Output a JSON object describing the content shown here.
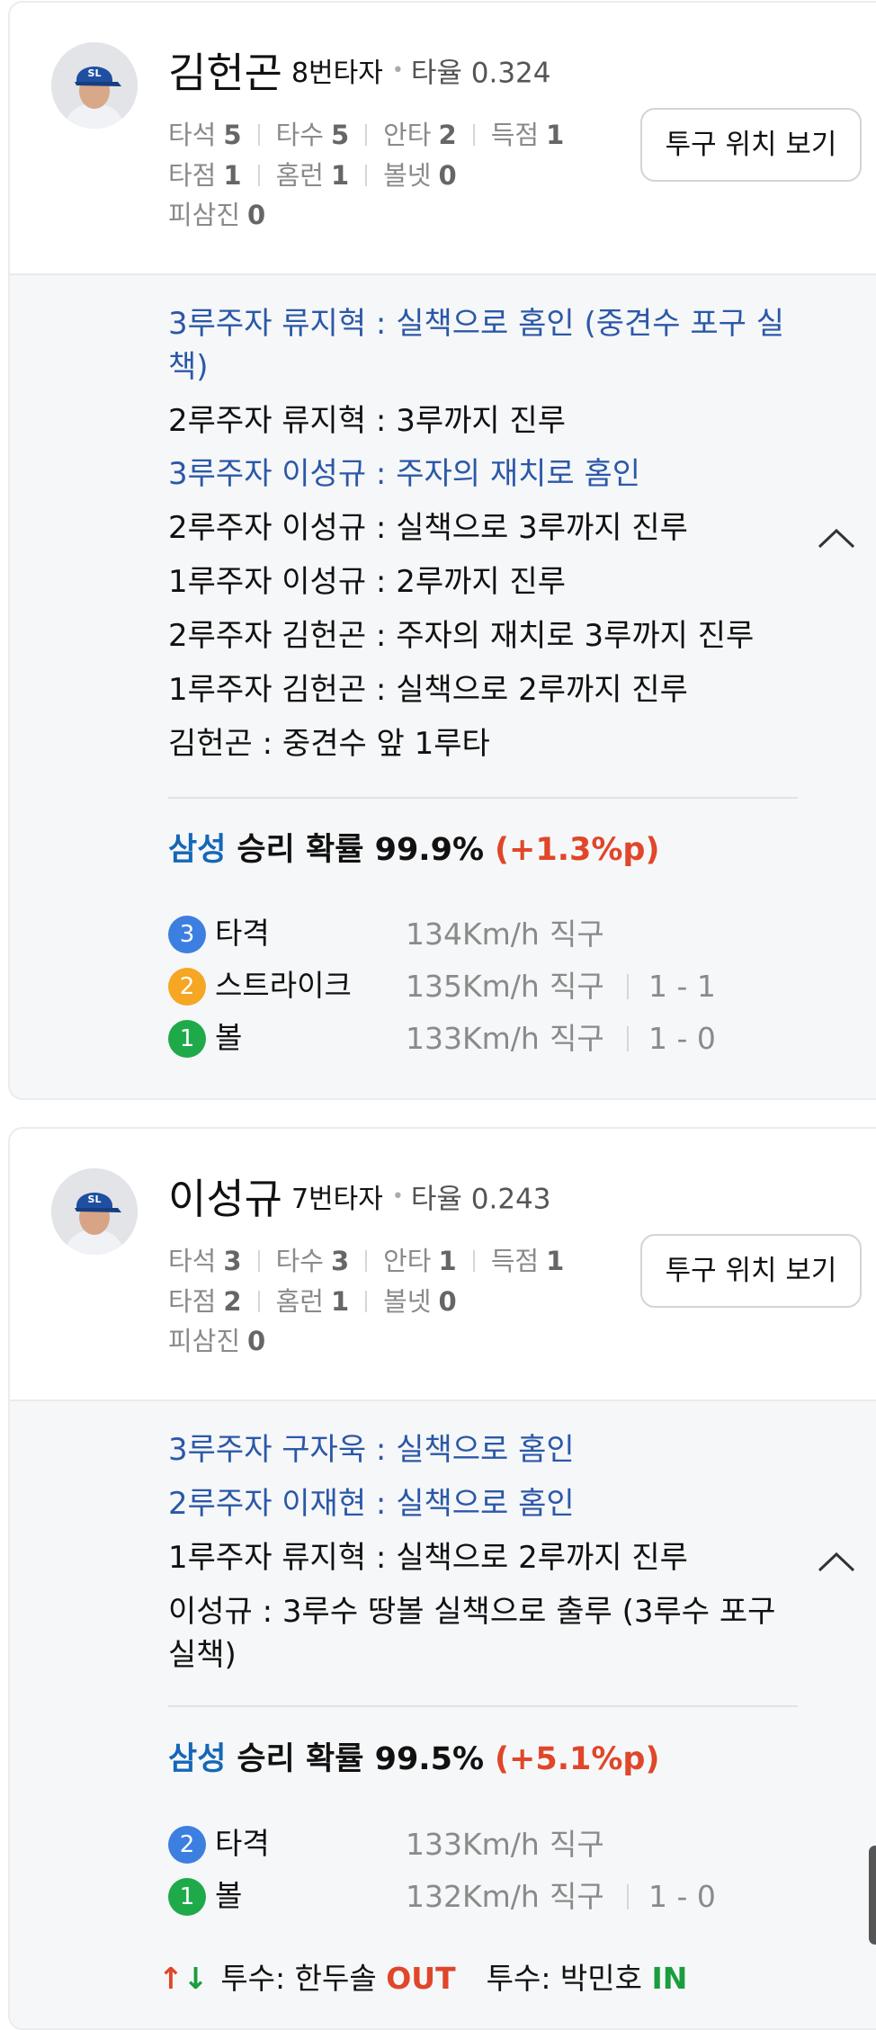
{
  "players": [
    {
      "name": "김헌곤",
      "order": "8번타자",
      "avg_label": "타율 0.324",
      "stats_row1": [
        {
          "label": "타석",
          "value": "5"
        },
        {
          "label": "타수",
          "value": "5"
        },
        {
          "label": "안타",
          "value": "2"
        },
        {
          "label": "득점",
          "value": "1"
        }
      ],
      "stats_row2": [
        {
          "label": "타점",
          "value": "1"
        },
        {
          "label": "홈런",
          "value": "1"
        },
        {
          "label": "볼넷",
          "value": "0"
        }
      ],
      "stats_row3": [
        {
          "label": "피삼진",
          "value": "0"
        }
      ],
      "pitch_button": "투구 위치 보기",
      "events": [
        {
          "text": "3루주자 류지혁 : 실책으로 홈인 (중견수 포구 실책)",
          "highlight": true
        },
        {
          "text": "2루주자 류지혁 : 3루까지 진루",
          "highlight": false
        },
        {
          "text": "3루주자 이성규 : 주자의 재치로 홈인",
          "highlight": true
        },
        {
          "text": "2루주자 이성규 : 실책으로 3루까지 진루",
          "highlight": false
        },
        {
          "text": "1루주자 이성규 : 2루까지 진루",
          "highlight": false
        },
        {
          "text": "2루주자 김헌곤 : 주자의 재치로 3루까지 진루",
          "highlight": false
        },
        {
          "text": "1루주자 김헌곤 : 실책으로 2루까지 진루",
          "highlight": false
        },
        {
          "text": "김헌곤 : 중견수 앞 1루타",
          "highlight": false
        }
      ],
      "win_prob": {
        "team": "삼성",
        "label": "승리 확률",
        "value": "99.9%",
        "diff": "(+1.3%p)"
      },
      "pitches": [
        {
          "num": "3",
          "type": "타격",
          "speed": "134Km/h",
          "kind": "직구",
          "count": "",
          "color": "#3d7fe0"
        },
        {
          "num": "2",
          "type": "스트라이크",
          "speed": "135Km/h",
          "kind": "직구",
          "count": "1 - 1",
          "color": "#f5a623"
        },
        {
          "num": "1",
          "type": "볼",
          "speed": "133Km/h",
          "kind": "직구",
          "count": "1 - 0",
          "color": "#1faa4a"
        }
      ]
    },
    {
      "name": "이성규",
      "order": "7번타자",
      "avg_label": "타율 0.243",
      "stats_row1": [
        {
          "label": "타석",
          "value": "3"
        },
        {
          "label": "타수",
          "value": "3"
        },
        {
          "label": "안타",
          "value": "1"
        },
        {
          "label": "득점",
          "value": "1"
        }
      ],
      "stats_row2": [
        {
          "label": "타점",
          "value": "2"
        },
        {
          "label": "홈런",
          "value": "1"
        },
        {
          "label": "볼넷",
          "value": "0"
        }
      ],
      "stats_row3": [
        {
          "label": "피삼진",
          "value": "0"
        }
      ],
      "pitch_button": "투구 위치 보기",
      "events": [
        {
          "text": "3루주자 구자욱 : 실책으로 홈인",
          "highlight": true
        },
        {
          "text": "2루주자 이재현 : 실책으로 홈인",
          "highlight": true
        },
        {
          "text": "1루주자 류지혁 : 실책으로 2루까지 진루",
          "highlight": false
        },
        {
          "text": "이성규 : 3루수 땅볼 실책으로 출루 (3루수 포구 실책)",
          "highlight": false
        }
      ],
      "win_prob": {
        "team": "삼성",
        "label": "승리 확률",
        "value": "99.5%",
        "diff": "(+5.1%p)"
      },
      "pitches": [
        {
          "num": "2",
          "type": "타격",
          "speed": "133Km/h",
          "kind": "직구",
          "count": "",
          "color": "#3d7fe0"
        },
        {
          "num": "1",
          "type": "볼",
          "speed": "132Km/h",
          "kind": "직구",
          "count": "1 - 0",
          "color": "#1faa4a"
        }
      ]
    }
  ],
  "substitution": {
    "out_prefix": "투수: 한두솔",
    "out_label": "OUT",
    "in_prefix": "투수: 박민호",
    "in_label": "IN",
    "arrow_up": "↑",
    "arrow_down": "↓"
  },
  "colors": {
    "highlight_text": "#2b58a8",
    "team": "#1467b8",
    "diff": "#e0462a",
    "out": "#e0462a",
    "in": "#1a9d3e"
  }
}
